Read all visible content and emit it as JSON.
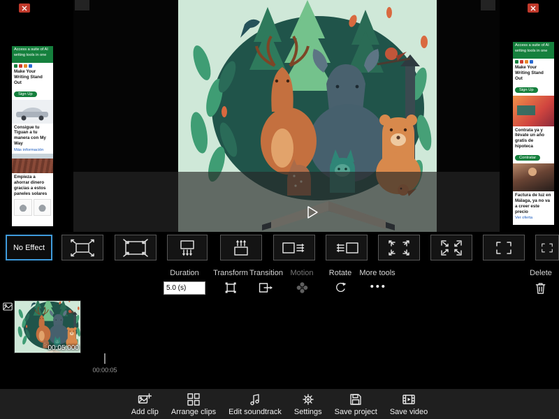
{
  "colors": {
    "accent_blue": "#3f9bdc",
    "ad_green": "#15803d",
    "bottom_bar_bg": "#1f1f1f",
    "preview_bg_mint": "#cfe8d8"
  },
  "ads": {
    "left": {
      "header": "Access a suite of AI writing tools in one",
      "ad1_title": "Make Your Writing Stand Out",
      "ad1_cta": "Sign Up",
      "ad2_title": "Consigue tu Tiguan a tu manera con My Way",
      "ad2_cta": "Más información",
      "ad3_title": "Empieza a ahorrar dinero gracias a estos paneles solares"
    },
    "right": {
      "header": "Access a suite of AI writing tools in one",
      "ad1_title": "Make Your Writing Stand Out",
      "ad1_cta": "Sign Up",
      "ad2_title": "Contrata ya y llévate un año gratis de hipoteca",
      "ad2_cta": "Contratar",
      "ad3_title": "Factura de luz en Málaga, ya no va a creer este precio",
      "ad3_cta": "Ver oferta"
    }
  },
  "effects": {
    "no_effect_label": "No Effect",
    "tiles": [
      "no-effect",
      "zoom-in",
      "zoom-out",
      "pan-down",
      "pan-up",
      "pan-right",
      "pan-left",
      "grow-corners",
      "shrink-corners",
      "frame",
      "frame-partial"
    ]
  },
  "controls": {
    "duration_label": "Duration",
    "duration_value": "5.0 (s)",
    "transform_label": "Transform",
    "transition_label": "Transition",
    "motion_label": "Motion",
    "rotate_label": "Rotate",
    "more_tools_label": "More tools",
    "delete_label": "Delete"
  },
  "timeline": {
    "clip_duration": "00:05.000",
    "ruler_label": "00:00:05"
  },
  "bottom_bar": {
    "buttons": [
      {
        "label": "Add clip"
      },
      {
        "label": "Arrange clips"
      },
      {
        "label": "Edit soundtrack"
      },
      {
        "label": "Settings"
      },
      {
        "label": "Save project"
      },
      {
        "label": "Save video"
      }
    ]
  }
}
